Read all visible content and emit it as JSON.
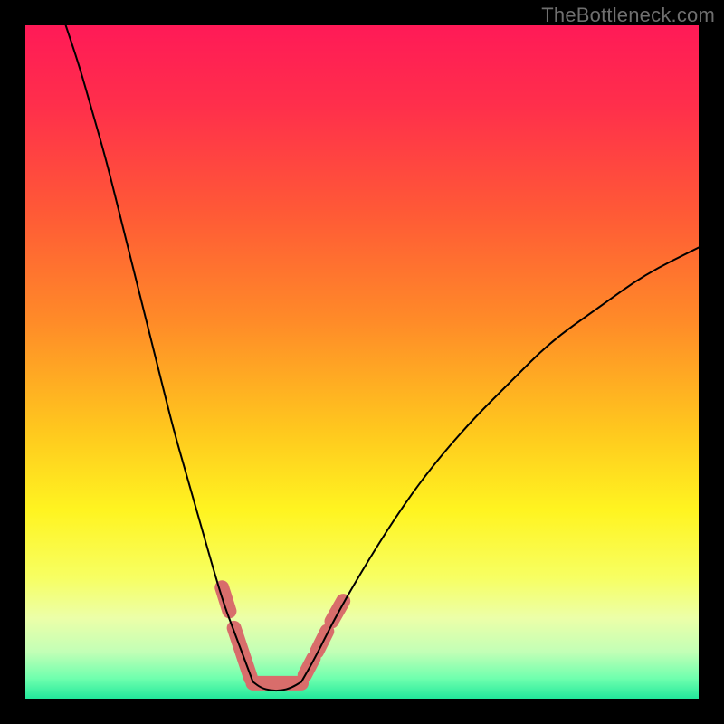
{
  "watermark": "TheBottleneck.com",
  "colors": {
    "gradient_stops": [
      {
        "offset": 0.0,
        "color": "#ff1a57"
      },
      {
        "offset": 0.12,
        "color": "#ff2f4b"
      },
      {
        "offset": 0.28,
        "color": "#ff5a36"
      },
      {
        "offset": 0.44,
        "color": "#ff8b28"
      },
      {
        "offset": 0.6,
        "color": "#ffc71e"
      },
      {
        "offset": 0.72,
        "color": "#fff420"
      },
      {
        "offset": 0.82,
        "color": "#f7ff62"
      },
      {
        "offset": 0.88,
        "color": "#ecffa8"
      },
      {
        "offset": 0.93,
        "color": "#c3ffb6"
      },
      {
        "offset": 0.97,
        "color": "#6fffae"
      },
      {
        "offset": 1.0,
        "color": "#22e89b"
      }
    ],
    "curve_stroke": "#000000",
    "segment_stroke": "#d86d6b",
    "frame": "#000000",
    "watermark": "#6f6f6f"
  },
  "chart_data": {
    "type": "line",
    "title": "",
    "xlabel": "",
    "ylabel": "",
    "xlim": [
      0,
      100
    ],
    "ylim": [
      0,
      100
    ],
    "annotations": [
      "TheBottleneck.com"
    ],
    "series": [
      {
        "name": "left-curve",
        "x": [
          6,
          8,
          10,
          12,
          14,
          16,
          18,
          20,
          22,
          24,
          26,
          28,
          29.5,
          31,
          32.5,
          33.8
        ],
        "y": [
          100,
          94,
          87,
          80,
          72,
          64,
          56,
          48,
          40,
          33,
          26,
          19,
          14,
          10,
          6,
          2.5
        ]
      },
      {
        "name": "valley-floor",
        "x": [
          33.8,
          35,
          36.5,
          38,
          39.5,
          41
        ],
        "y": [
          2.5,
          1.6,
          1.2,
          1.2,
          1.6,
          2.5
        ]
      },
      {
        "name": "right-curve",
        "x": [
          41,
          43,
          46,
          50,
          55,
          60,
          66,
          72,
          78,
          85,
          92,
          100
        ],
        "y": [
          2.5,
          6,
          12,
          19,
          27,
          34,
          41,
          47,
          53,
          58,
          63,
          67
        ]
      }
    ],
    "highlight_segments": [
      {
        "name": "left-seg-upper",
        "x": [
          29.2,
          30.3
        ],
        "y": [
          16.5,
          13.0
        ]
      },
      {
        "name": "left-seg-lower",
        "x": [
          31.0,
          33.5
        ],
        "y": [
          10.5,
          3.0
        ]
      },
      {
        "name": "valley-seg",
        "x": [
          33.8,
          41.0
        ],
        "y": [
          2.3,
          2.3
        ]
      },
      {
        "name": "right-seg-low1",
        "x": [
          41.5,
          42.8
        ],
        "y": [
          3.5,
          6.0
        ]
      },
      {
        "name": "right-seg-low2",
        "x": [
          43.3,
          44.8
        ],
        "y": [
          7.0,
          10.0
        ]
      },
      {
        "name": "right-seg-up",
        "x": [
          45.5,
          47.2
        ],
        "y": [
          11.5,
          14.5
        ]
      }
    ]
  }
}
